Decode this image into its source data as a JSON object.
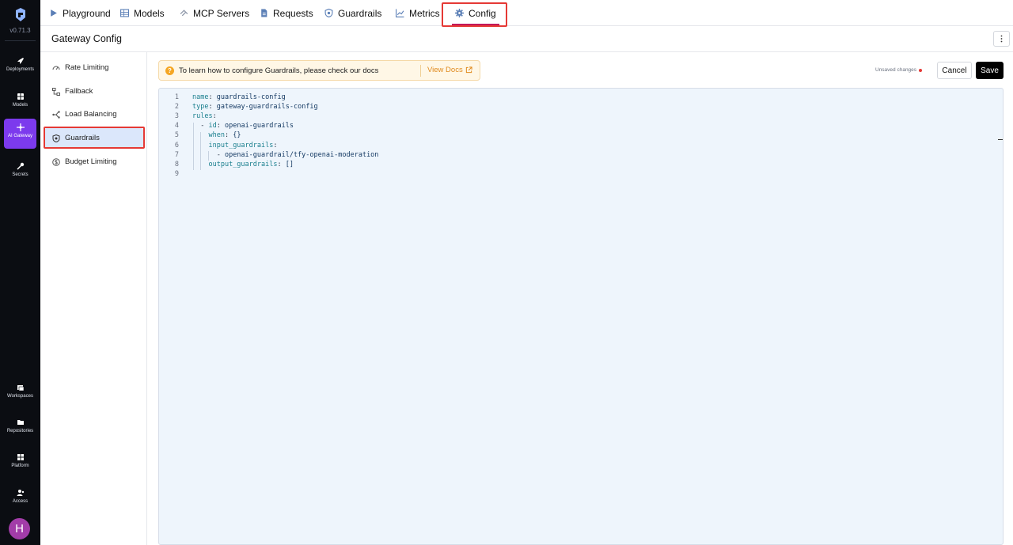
{
  "rail": {
    "version": "v0.71.3",
    "items": [
      {
        "label": "Deployments",
        "icon": "rocket-icon"
      },
      {
        "label": "Models",
        "icon": "grid-icon"
      },
      {
        "label": "AI Gateway",
        "icon": "gateway-icon",
        "active": true
      },
      {
        "label": "Secrets",
        "icon": "key-icon"
      },
      {
        "label": "Workspaces",
        "icon": "workspace-icon"
      },
      {
        "label": "Repositories",
        "icon": "folder-icon"
      },
      {
        "label": "Platform",
        "icon": "platform-icon"
      },
      {
        "label": "Access",
        "icon": "users-icon"
      }
    ],
    "avatar_initial": "H"
  },
  "topnav": {
    "tabs": [
      {
        "label": "Playground",
        "icon": "play-icon"
      },
      {
        "label": "Models",
        "icon": "table-icon"
      },
      {
        "label": "MCP Servers",
        "icon": "mcp-icon"
      },
      {
        "label": "Requests",
        "icon": "document-icon"
      },
      {
        "label": "Guardrails",
        "icon": "shield-icon"
      },
      {
        "label": "Metrics",
        "icon": "chart-icon"
      },
      {
        "label": "Config",
        "icon": "gear-icon",
        "active": true
      }
    ]
  },
  "header": {
    "title": "Gateway Config"
  },
  "sidebar": {
    "items": [
      {
        "label": "Rate Limiting",
        "icon": "gauge-icon"
      },
      {
        "label": "Fallback",
        "icon": "fallback-icon"
      },
      {
        "label": "Load Balancing",
        "icon": "balance-icon"
      },
      {
        "label": "Guardrails",
        "icon": "shield-icon",
        "active": true
      },
      {
        "label": "Budget Limiting",
        "icon": "dollar-icon"
      }
    ]
  },
  "banner": {
    "text": "To learn how to configure Guardrails, please check our docs",
    "link_label": "View Docs"
  },
  "actions": {
    "unsaved_label": "Unsaved changes",
    "cancel_label": "Cancel",
    "save_label": "Save"
  },
  "editor": {
    "lines": [
      {
        "n": "1",
        "key": "name",
        "sep": ": ",
        "val": "guardrails-config",
        "indent": ""
      },
      {
        "n": "2",
        "key": "type",
        "sep": ": ",
        "val": "gateway-guardrails-config",
        "indent": ""
      },
      {
        "n": "3",
        "key": "rules",
        "sep": ":",
        "val": "",
        "indent": ""
      },
      {
        "n": "4",
        "key": "id",
        "sep": ": ",
        "val": "openai-guardrails",
        "indent": "  - "
      },
      {
        "n": "5",
        "key": "when",
        "sep": ": ",
        "val": "{}",
        "indent": "    "
      },
      {
        "n": "6",
        "key": "input_guardrails",
        "sep": ":",
        "val": "",
        "indent": "    "
      },
      {
        "n": "7",
        "key": "",
        "sep": "",
        "val": "openai-guardrail/tfy-openai-moderation",
        "indent": "      - "
      },
      {
        "n": "8",
        "key": "output_guardrails",
        "sep": ": ",
        "val": "[]",
        "indent": "    "
      },
      {
        "n": "9",
        "key": "",
        "sep": "",
        "val": "",
        "indent": ""
      }
    ]
  }
}
